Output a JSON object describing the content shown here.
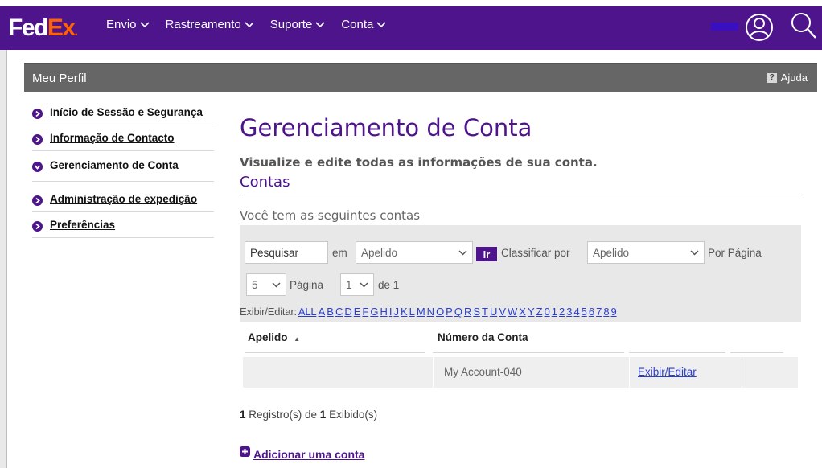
{
  "header": {
    "logo": {
      "part1": "Fed",
      "part2": "Ex",
      "suffix": "."
    },
    "nav": [
      {
        "label": "Envio"
      },
      {
        "label": "Rastreamento"
      },
      {
        "label": "Suporte"
      },
      {
        "label": "Conta"
      }
    ],
    "colors": {
      "brand_purple": "#4d148c",
      "brand_orange": "#ff6200"
    }
  },
  "profile_bar": {
    "title": "Meu Perfil",
    "help_icon": "?",
    "help_label": "Ajuda"
  },
  "sidebar": {
    "items": [
      {
        "label": "Início de Sessão e Segurança",
        "active": false
      },
      {
        "label": "Informação de Contacto",
        "active": false
      },
      {
        "label": "Gerenciamento de Conta",
        "active": true
      },
      {
        "label": "Administração de expedição",
        "active": false
      },
      {
        "label": "Preferências",
        "active": false
      }
    ]
  },
  "main": {
    "title": "Gerenciamento de Conta",
    "subtitle": "Visualize e edite todas as informações de sua conta.",
    "section_title": "Contas",
    "intro": "Você tem as seguintes contas"
  },
  "filters": {
    "search_value": "Pesquisar",
    "in_label": "em",
    "field_select": "Apelido",
    "go_label": "Ir",
    "sort_label": "Classificar por",
    "sort_select": "Apelido",
    "per_page_label": "Por Página",
    "per_page_select": "5",
    "page_label": "Página",
    "page_select": "1",
    "of_label": "de 1"
  },
  "alpha_filter": {
    "label": "Exibir/Editar:",
    "links": [
      "ALL",
      "A",
      "B",
      "C",
      "D",
      "E",
      "F",
      "G",
      "H",
      "I",
      "J",
      "K",
      "L",
      "M",
      "N",
      "O",
      "P",
      "Q",
      "R",
      "S",
      "T",
      "U",
      "V",
      "W",
      "X",
      "Y",
      "Z",
      "0",
      "1",
      "2",
      "3",
      "4",
      "5",
      "6",
      "7",
      "8",
      "9"
    ]
  },
  "table": {
    "headers": {
      "nickname": "Apelido",
      "sort_indicator": "▲",
      "account_number": "Número da Conta"
    },
    "rows": [
      {
        "nickname": "",
        "account_number": "My Account-040",
        "action": "Exibir/Editar"
      }
    ]
  },
  "records": {
    "count": "1",
    "mid": " Registro(s) de ",
    "total": "1",
    "suffix": " Exibido(s)"
  },
  "add_account": {
    "label": "Adicionar uma conta"
  }
}
